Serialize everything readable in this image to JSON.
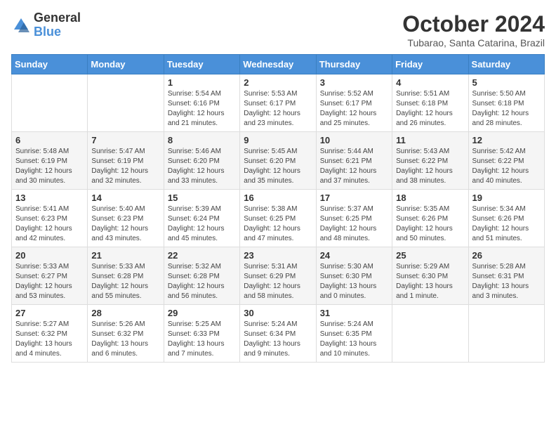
{
  "header": {
    "logo_general": "General",
    "logo_blue": "Blue",
    "month_year": "October 2024",
    "location": "Tubarao, Santa Catarina, Brazil"
  },
  "days_of_week": [
    "Sunday",
    "Monday",
    "Tuesday",
    "Wednesday",
    "Thursday",
    "Friday",
    "Saturday"
  ],
  "weeks": [
    [
      {
        "day": "",
        "info": ""
      },
      {
        "day": "",
        "info": ""
      },
      {
        "day": "1",
        "info": "Sunrise: 5:54 AM\nSunset: 6:16 PM\nDaylight: 12 hours and 21 minutes."
      },
      {
        "day": "2",
        "info": "Sunrise: 5:53 AM\nSunset: 6:17 PM\nDaylight: 12 hours and 23 minutes."
      },
      {
        "day": "3",
        "info": "Sunrise: 5:52 AM\nSunset: 6:17 PM\nDaylight: 12 hours and 25 minutes."
      },
      {
        "day": "4",
        "info": "Sunrise: 5:51 AM\nSunset: 6:18 PM\nDaylight: 12 hours and 26 minutes."
      },
      {
        "day": "5",
        "info": "Sunrise: 5:50 AM\nSunset: 6:18 PM\nDaylight: 12 hours and 28 minutes."
      }
    ],
    [
      {
        "day": "6",
        "info": "Sunrise: 5:48 AM\nSunset: 6:19 PM\nDaylight: 12 hours and 30 minutes."
      },
      {
        "day": "7",
        "info": "Sunrise: 5:47 AM\nSunset: 6:19 PM\nDaylight: 12 hours and 32 minutes."
      },
      {
        "day": "8",
        "info": "Sunrise: 5:46 AM\nSunset: 6:20 PM\nDaylight: 12 hours and 33 minutes."
      },
      {
        "day": "9",
        "info": "Sunrise: 5:45 AM\nSunset: 6:20 PM\nDaylight: 12 hours and 35 minutes."
      },
      {
        "day": "10",
        "info": "Sunrise: 5:44 AM\nSunset: 6:21 PM\nDaylight: 12 hours and 37 minutes."
      },
      {
        "day": "11",
        "info": "Sunrise: 5:43 AM\nSunset: 6:22 PM\nDaylight: 12 hours and 38 minutes."
      },
      {
        "day": "12",
        "info": "Sunrise: 5:42 AM\nSunset: 6:22 PM\nDaylight: 12 hours and 40 minutes."
      }
    ],
    [
      {
        "day": "13",
        "info": "Sunrise: 5:41 AM\nSunset: 6:23 PM\nDaylight: 12 hours and 42 minutes."
      },
      {
        "day": "14",
        "info": "Sunrise: 5:40 AM\nSunset: 6:23 PM\nDaylight: 12 hours and 43 minutes."
      },
      {
        "day": "15",
        "info": "Sunrise: 5:39 AM\nSunset: 6:24 PM\nDaylight: 12 hours and 45 minutes."
      },
      {
        "day": "16",
        "info": "Sunrise: 5:38 AM\nSunset: 6:25 PM\nDaylight: 12 hours and 47 minutes."
      },
      {
        "day": "17",
        "info": "Sunrise: 5:37 AM\nSunset: 6:25 PM\nDaylight: 12 hours and 48 minutes."
      },
      {
        "day": "18",
        "info": "Sunrise: 5:35 AM\nSunset: 6:26 PM\nDaylight: 12 hours and 50 minutes."
      },
      {
        "day": "19",
        "info": "Sunrise: 5:34 AM\nSunset: 6:26 PM\nDaylight: 12 hours and 51 minutes."
      }
    ],
    [
      {
        "day": "20",
        "info": "Sunrise: 5:33 AM\nSunset: 6:27 PM\nDaylight: 12 hours and 53 minutes."
      },
      {
        "day": "21",
        "info": "Sunrise: 5:33 AM\nSunset: 6:28 PM\nDaylight: 12 hours and 55 minutes."
      },
      {
        "day": "22",
        "info": "Sunrise: 5:32 AM\nSunset: 6:28 PM\nDaylight: 12 hours and 56 minutes."
      },
      {
        "day": "23",
        "info": "Sunrise: 5:31 AM\nSunset: 6:29 PM\nDaylight: 12 hours and 58 minutes."
      },
      {
        "day": "24",
        "info": "Sunrise: 5:30 AM\nSunset: 6:30 PM\nDaylight: 13 hours and 0 minutes."
      },
      {
        "day": "25",
        "info": "Sunrise: 5:29 AM\nSunset: 6:30 PM\nDaylight: 13 hours and 1 minute."
      },
      {
        "day": "26",
        "info": "Sunrise: 5:28 AM\nSunset: 6:31 PM\nDaylight: 13 hours and 3 minutes."
      }
    ],
    [
      {
        "day": "27",
        "info": "Sunrise: 5:27 AM\nSunset: 6:32 PM\nDaylight: 13 hours and 4 minutes."
      },
      {
        "day": "28",
        "info": "Sunrise: 5:26 AM\nSunset: 6:32 PM\nDaylight: 13 hours and 6 minutes."
      },
      {
        "day": "29",
        "info": "Sunrise: 5:25 AM\nSunset: 6:33 PM\nDaylight: 13 hours and 7 minutes."
      },
      {
        "day": "30",
        "info": "Sunrise: 5:24 AM\nSunset: 6:34 PM\nDaylight: 13 hours and 9 minutes."
      },
      {
        "day": "31",
        "info": "Sunrise: 5:24 AM\nSunset: 6:35 PM\nDaylight: 13 hours and 10 minutes."
      },
      {
        "day": "",
        "info": ""
      },
      {
        "day": "",
        "info": ""
      }
    ]
  ]
}
